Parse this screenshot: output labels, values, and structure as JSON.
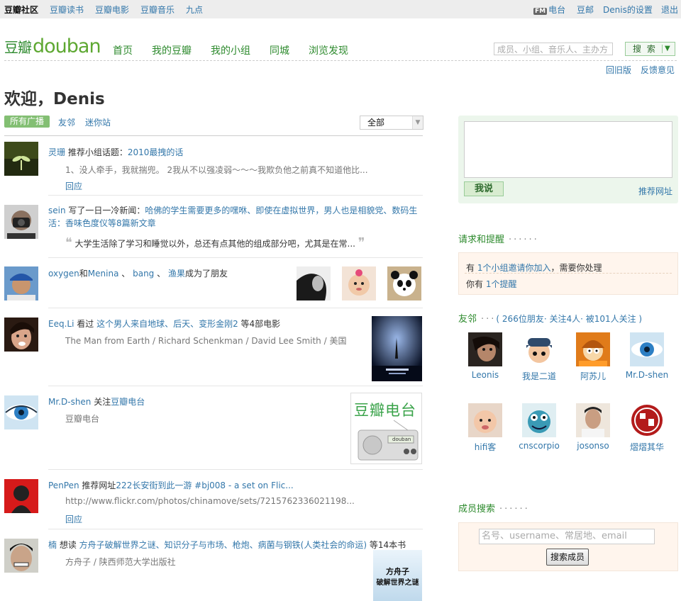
{
  "topbar": {
    "links": [
      "豆瓣社区",
      "豆瓣读书",
      "豆瓣电影",
      "豆瓣音乐",
      "九点"
    ],
    "fm_badge": "FM",
    "right": [
      "电台",
      "豆邮",
      "Denis的设置",
      "退出"
    ]
  },
  "header": {
    "logo_cn": "豆瓣",
    "logo_en": "douban",
    "nav": [
      "首页",
      "我的豆瓣",
      "我的小组",
      "同城",
      "浏览发现"
    ],
    "search_placeholder": "成员、小组、音乐人、主办方",
    "search_button": "搜 索",
    "old_version": "回旧版",
    "feedback": "反馈意见"
  },
  "welcome": "欢迎，Denis",
  "tabs": {
    "active": "所有广播",
    "items": [
      "友邻",
      "迷你站"
    ],
    "filter": "全部"
  },
  "feed": [
    {
      "user": "灵珊",
      "action": " 推荐小组话题：",
      "target": "2010最拽的话",
      "sub": "1、没人牵手，我就揣兜。 2我从不以强凌弱～～～我欺负他之前真不知道他比...",
      "reply": "回应"
    },
    {
      "user": "sein",
      "action": " 写了一日一冷新闻：",
      "target": "哈佛的学生需要更多的嘿咻、即使在虚拟世界，男人也是相貌党、数码生活：香味色度仪等8篇新文章",
      "quote": "大学生活除了学习和睡觉以外，总还有点其他的组成部分吧，尤其是在常..."
    },
    {
      "user": "oxygen",
      "and": "和",
      "user2": "Menina",
      "comma1": " 、",
      "user3": "bang",
      "comma2": " 、",
      "user4": "渔果",
      "action": "成为了朋友"
    },
    {
      "user": "Eeq.Li",
      "action": " 看过 ",
      "target": "这个男人来自地球、后天、变形金刚2",
      "suffix": " 等4部电影",
      "sub": "The Man from Earth / Richard Schenkman / David Lee Smith / 美国"
    },
    {
      "user": "Mr.D-shen",
      "action": " 关注",
      "target": "豆瓣电台",
      "sub": "豆瓣电台",
      "thumb_text": "豆瓣电台",
      "radio_label": "douban"
    },
    {
      "user": "PenPen",
      "action": " 推荐网址",
      "target": "222长安街到此一游 #bj008 - a set on Flic...",
      "sub": "http://www.flickr.com/photos/chinamove/sets/7215762336021198...",
      "reply": "回应"
    },
    {
      "user": "楠",
      "action": " 想读 ",
      "target": "方舟子破解世界之谜、知识分子与市场、枪炮、病菌与钢铁(人类社会的命运)",
      "suffix": " 等14本书",
      "sub": "方舟子 / 陕西师范大学出版社",
      "book_title": "方舟子",
      "book_sub": "破解世界之谜"
    }
  ],
  "sidebar": {
    "say_button": "我说",
    "recommend_url": "推荐网址",
    "requests": {
      "title": "请求和提醒",
      "line1_pre": "有 ",
      "line1_link": "1个小组邀请你加入",
      "line1_post": "，需要你处理",
      "line2_pre": "你有 ",
      "line2_link": "1个提醒"
    },
    "friends": {
      "title": "友邻",
      "summary": "( 266位朋友· 关注4人· 被101人关注 )",
      "list": [
        {
          "name": "Leonis",
          "color": "#6b4a3a"
        },
        {
          "name": "我是二道",
          "color": "#2f4a6b"
        },
        {
          "name": "阿苏儿",
          "color": "#e07b1a"
        },
        {
          "name": "Mr.D-shen",
          "color": "#3a7fc0"
        },
        {
          "name": "hifi客",
          "color": "#b98a6a"
        },
        {
          "name": "cnscorpio",
          "color": "#3a9ab5"
        },
        {
          "name": "josonso",
          "color": "#8a6a55"
        },
        {
          "name": "熠熠其华",
          "color": "#b31b1b"
        }
      ],
      "badge_text": "我是二道"
    },
    "member_search": {
      "title": "成员搜索",
      "placeholder": "名号、username、常居地、email",
      "button": "搜索成员"
    }
  }
}
